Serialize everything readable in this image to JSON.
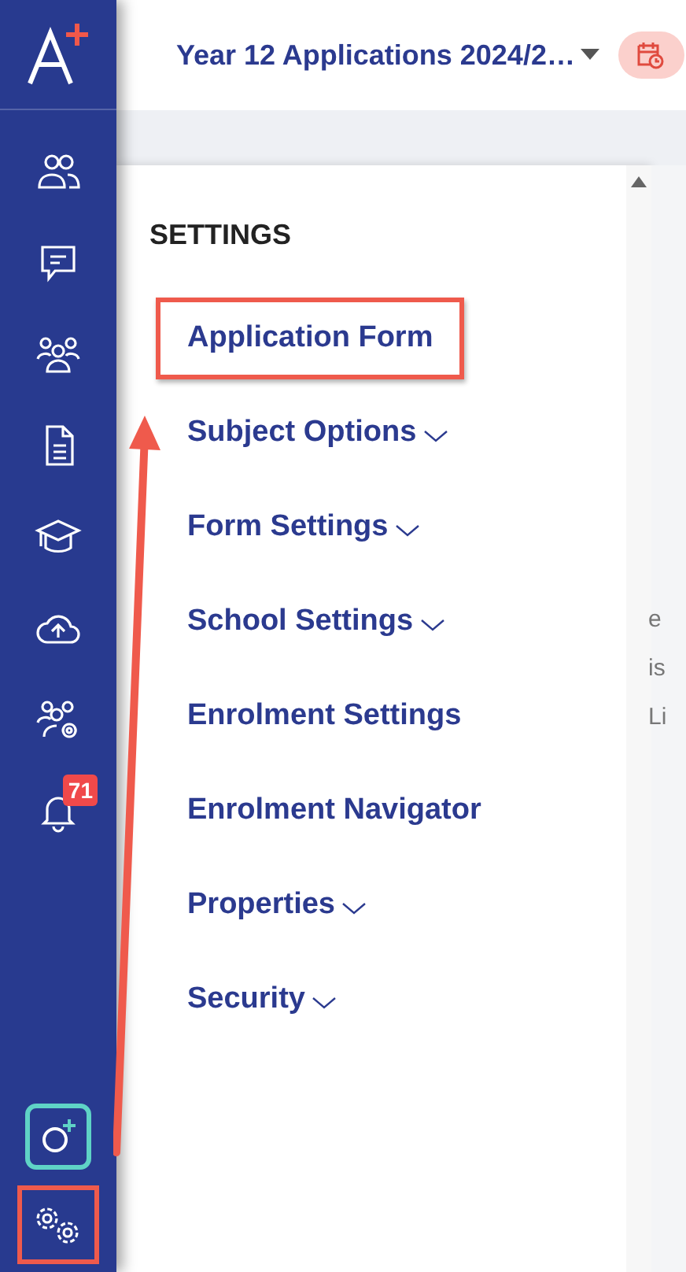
{
  "header": {
    "title": "Year 12 Applications 2024/2…"
  },
  "nav": {
    "items": [
      {
        "kind": "people"
      },
      {
        "kind": "chat"
      },
      {
        "kind": "group"
      },
      {
        "kind": "document"
      },
      {
        "kind": "cap"
      },
      {
        "kind": "upload"
      },
      {
        "kind": "people-gear"
      },
      {
        "kind": "bell",
        "badge": "71"
      }
    ],
    "bottom": [
      {
        "kind": "add",
        "highlighted": false
      },
      {
        "kind": "settings",
        "highlighted": true
      }
    ]
  },
  "menu": {
    "heading": "SETTINGS",
    "items": [
      {
        "label": "Application Form",
        "expandable": false,
        "highlighted": true
      },
      {
        "label": "Subject Options",
        "expandable": true,
        "highlighted": false
      },
      {
        "label": "Form Settings",
        "expandable": true,
        "highlighted": false
      },
      {
        "label": "School Settings",
        "expandable": true,
        "highlighted": false
      },
      {
        "label": "Enrolment Settings",
        "expandable": false,
        "highlighted": false
      },
      {
        "label": "Enrolment Navigator",
        "expandable": false,
        "highlighted": false
      },
      {
        "label": "Properties",
        "expandable": true,
        "highlighted": false
      },
      {
        "label": "Security",
        "expandable": true,
        "highlighted": false
      }
    ]
  },
  "background_fragments": [
    "e",
    "is",
    "Li"
  ]
}
